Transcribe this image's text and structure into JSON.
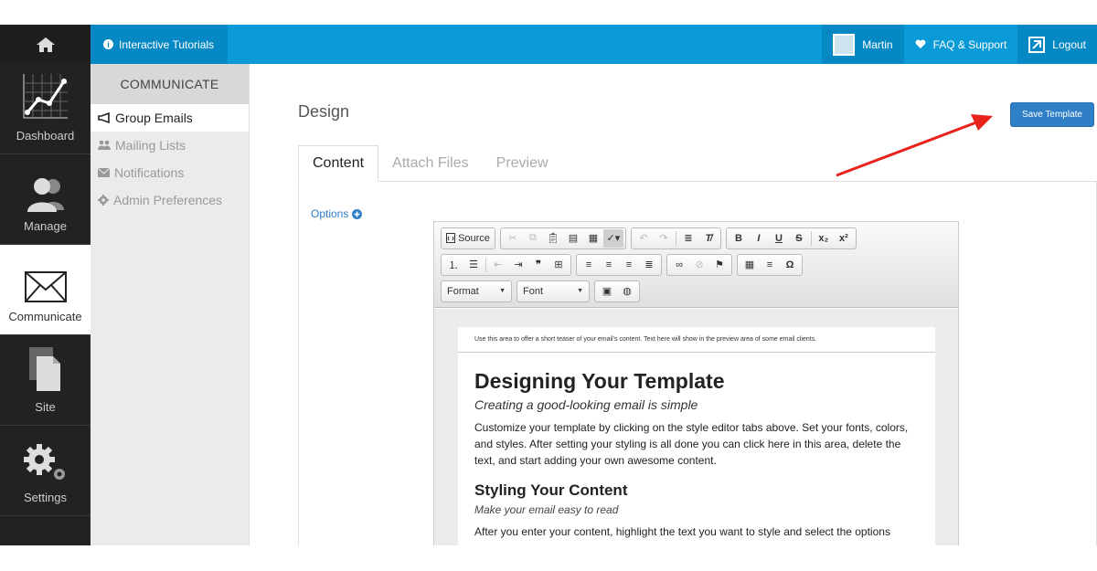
{
  "topbar": {
    "tutorials": "Interactive Tutorials",
    "user": "Martin",
    "faq": "FAQ & Support",
    "logout": "Logout"
  },
  "leftnav": {
    "items": [
      {
        "label": "Dashboard"
      },
      {
        "label": "Manage"
      },
      {
        "label": "Communicate"
      },
      {
        "label": "Site"
      },
      {
        "label": "Settings"
      }
    ]
  },
  "subnav": {
    "header": "COMMUNICATE",
    "items": [
      {
        "label": "Group Emails"
      },
      {
        "label": "Mailing Lists"
      },
      {
        "label": "Notifications"
      },
      {
        "label": "Admin Preferences"
      }
    ]
  },
  "main": {
    "title": "Design",
    "save_label": "Save Template",
    "tabs": [
      {
        "label": "Content"
      },
      {
        "label": "Attach Files"
      },
      {
        "label": "Preview"
      }
    ],
    "options_label": "Options"
  },
  "editor": {
    "source_label": "Source",
    "format_label": "Format",
    "font_label": "Font",
    "teaser": "Use this area to offer a short teaser of your email's content. Text here will show in the preview area of some email clients.",
    "heading": "Designing Your Template",
    "subheading": "Creating a good-looking email is simple",
    "paragraph": "Customize your template by clicking on the style editor tabs above. Set your fonts, colors, and styles. After setting your styling is all done you can click here in this area, delete the text, and start adding your own awesome content.",
    "heading2": "Styling Your Content",
    "subheading2": "Make your email easy to read",
    "paragraph2": "After you enter your content, highlight the text you want to style and select the options"
  },
  "colors": {
    "accent": "#0a9ad7",
    "save_button": "#2f7fc6",
    "arrow": "#e8231c"
  }
}
